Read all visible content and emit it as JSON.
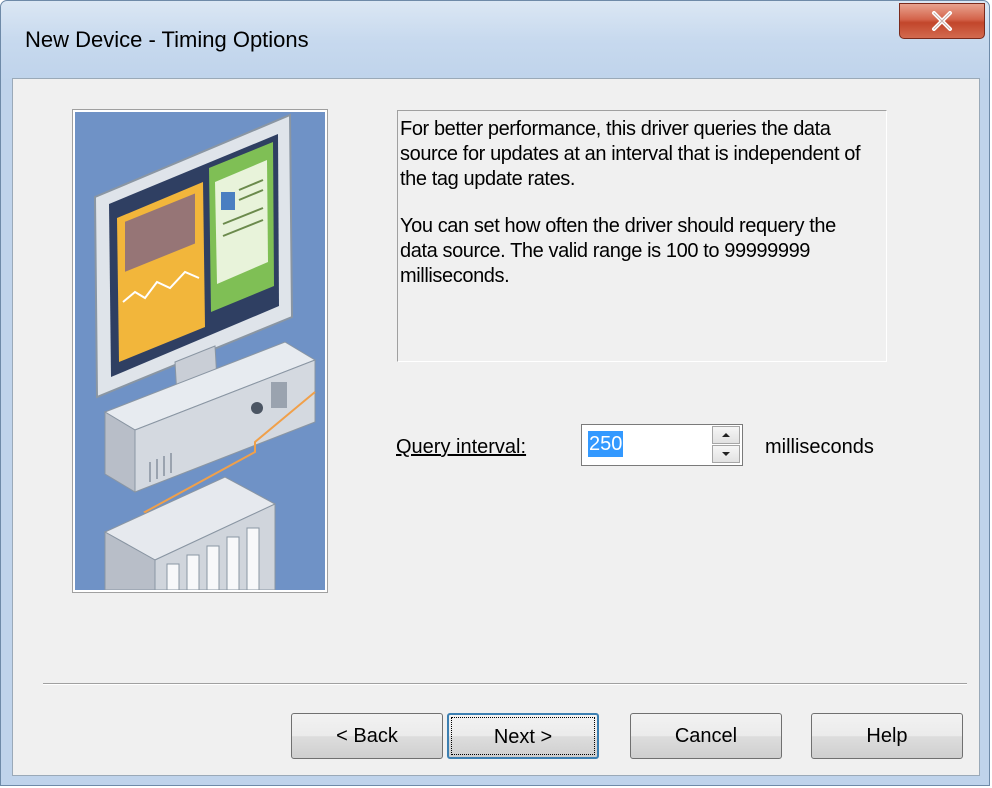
{
  "window": {
    "title": "New Device - Timing Options",
    "close_symbol": "x"
  },
  "description": {
    "paragraph1": "For better performance, this driver queries the data source for updates at an interval that is independent of the tag update rates.",
    "paragraph2": "You can set how often the driver should requery the data source.  The valid range is 100 to 99999999 milliseconds."
  },
  "query": {
    "label": "Query interval:",
    "value": "250",
    "unit": "milliseconds"
  },
  "buttons": {
    "back": "< Back",
    "next": "Next >",
    "cancel": "Cancel",
    "help": "Help"
  },
  "illustration": {
    "name": "computer-and-plc-illustration",
    "background_color": "#6f92c6"
  }
}
